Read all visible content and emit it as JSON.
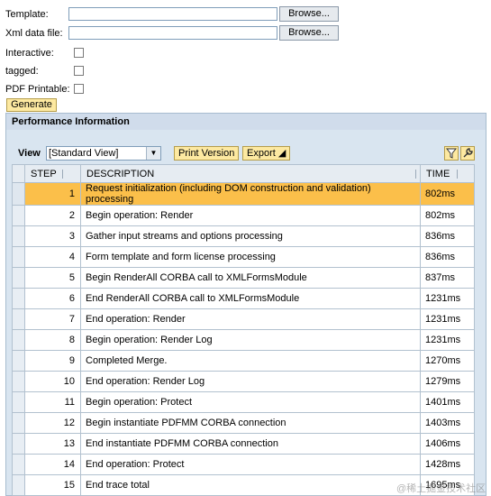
{
  "form": {
    "template_label": "Template:",
    "xml_label": "Xml data file:",
    "browse_label": "Browse...",
    "interactive_label": "Interactive:",
    "tagged_label": "tagged:",
    "pdf_printable_label": "PDF Printable:",
    "generate_label": "Generate"
  },
  "panel": {
    "title": "Performance Information",
    "view_label": "View",
    "view_value": "[Standard View]",
    "print_label": "Print Version",
    "export_label": "Export ◢"
  },
  "table": {
    "headers": {
      "step": "STEP",
      "description": "DESCRIPTION",
      "time": "TIME"
    },
    "rows": [
      {
        "step": "1",
        "description": "Request initialization (including DOM construction and validation) processing",
        "time": "802ms"
      },
      {
        "step": "2",
        "description": "Begin operation: Render",
        "time": "802ms"
      },
      {
        "step": "3",
        "description": "Gather input streams and options processing",
        "time": "836ms"
      },
      {
        "step": "4",
        "description": "Form template and form license processing",
        "time": "836ms"
      },
      {
        "step": "5",
        "description": "Begin RenderAll CORBA call to XMLFormsModule",
        "time": "837ms"
      },
      {
        "step": "6",
        "description": "End RenderAll CORBA call to XMLFormsModule",
        "time": "1231ms"
      },
      {
        "step": "7",
        "description": "End operation: Render",
        "time": "1231ms"
      },
      {
        "step": "8",
        "description": "Begin operation: Render Log",
        "time": "1231ms"
      },
      {
        "step": "9",
        "description": "Completed Merge.",
        "time": "1270ms"
      },
      {
        "step": "10",
        "description": "End operation: Render Log",
        "time": "1279ms"
      },
      {
        "step": "11",
        "description": "Begin operation: Protect",
        "time": "1401ms"
      },
      {
        "step": "12",
        "description": "Begin instantiate PDFMM CORBA connection",
        "time": "1403ms"
      },
      {
        "step": "13",
        "description": "End instantiate PDFMM CORBA connection",
        "time": "1406ms"
      },
      {
        "step": "14",
        "description": "End operation: Protect",
        "time": "1428ms"
      },
      {
        "step": "15",
        "description": "End trace total",
        "time": "1695ms"
      }
    ]
  },
  "watermark": "@稀土掘金技术社区"
}
